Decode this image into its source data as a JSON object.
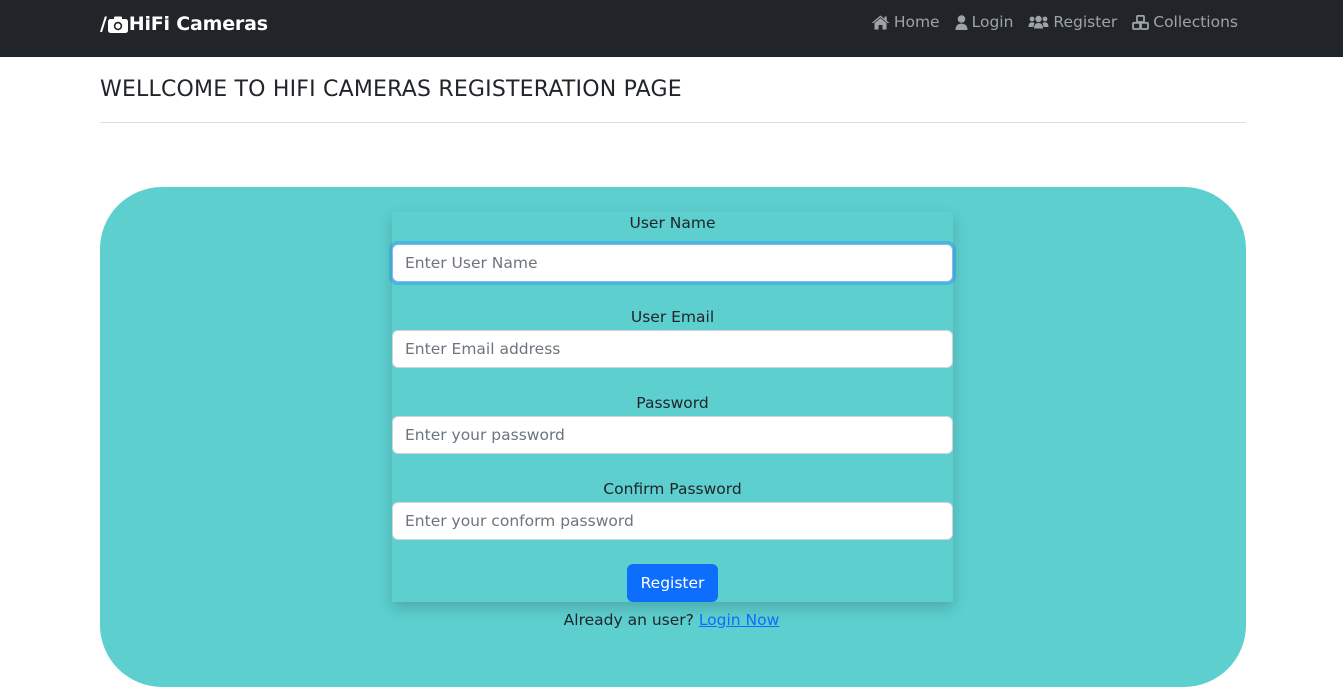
{
  "navbar": {
    "brand_prefix": "/",
    "brand_name": "HiFi Cameras",
    "brand_icon": "camera-icon",
    "links": [
      {
        "label": "Home",
        "icon": "home-icon"
      },
      {
        "label": "Login",
        "icon": "user-icon"
      },
      {
        "label": "Register",
        "icon": "users-icon"
      },
      {
        "label": "Collections",
        "icon": "cubes-icon"
      }
    ]
  },
  "header": {
    "title": "WELLCOME TO HIFI CAMERAS REGISTERATION PAGE"
  },
  "form": {
    "username": {
      "label": "User Name",
      "value": "",
      "placeholder": "Enter User Name"
    },
    "email": {
      "label": "User Email",
      "value": "",
      "placeholder": "Enter Email address"
    },
    "password": {
      "label": "Password",
      "value": "",
      "placeholder": "Enter your password"
    },
    "confirm_password": {
      "label": "Confirm Password",
      "value": "",
      "placeholder": "Enter your conform password"
    },
    "submit_label": "Register"
  },
  "footer": {
    "prompt": "Already an user?",
    "login_link": "Login Now"
  },
  "colors": {
    "navbar_bg": "#212529",
    "panel_bg": "#5dcfcf",
    "primary": "#0d6efd",
    "nav_link": "#9ea3a8"
  }
}
